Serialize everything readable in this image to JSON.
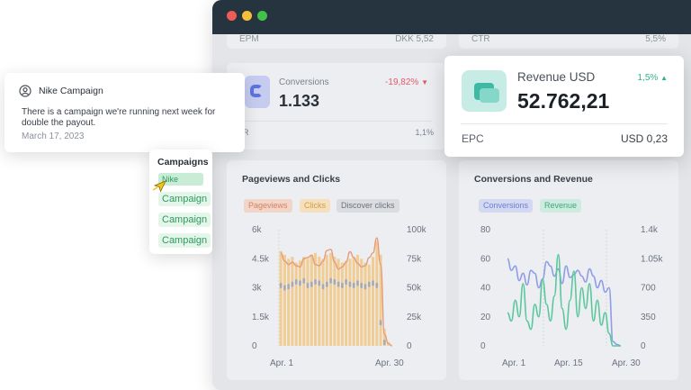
{
  "window": {},
  "top_row": {
    "epm_label": "EPM",
    "epm_value": "DKK 5,52",
    "ctr_label": "CTR",
    "ctr_value": "5,5%"
  },
  "conversions_card": {
    "title": "Conversions",
    "value": "1.133",
    "change": "-19,82%",
    "sub_label": "R",
    "sub_value": "1,1%"
  },
  "revenue_card": {
    "title": "Revenue USD",
    "change": "1,5%",
    "value": "52.762,21",
    "epc_label": "EPC",
    "epc_value": "USD 0,23"
  },
  "notification": {
    "title": "Nike Campaign",
    "body": "There is a campaign we're running next week for double the payout.",
    "date": "March 17, 2023"
  },
  "campaigns_popup": {
    "title": "Campaigns",
    "items": [
      "Nike",
      "Campaign",
      "Campaign",
      "Campaign"
    ]
  },
  "colors": {
    "pageviews": "#e59b7c",
    "clicks": "#f2c98a",
    "conversions": "#8f9de6",
    "revenue": "#5cc79c",
    "negative": "#e05a6a",
    "positive": "#2fb58f"
  },
  "chart_data": [
    {
      "type": "bar",
      "title": "Pageviews and Clicks",
      "legend": [
        "Pageviews",
        "Clicks",
        "Discover clicks"
      ],
      "x_tick_labels": [
        "Apr. 1",
        "Apr. 30"
      ],
      "y_left_ticks": [
        "6k",
        "4.5k",
        "3k",
        "1.5k",
        "0"
      ],
      "y_right_ticks": [
        "100k",
        "75k",
        "50k",
        "25k",
        "0"
      ],
      "ylim_left": [
        0,
        6000
      ],
      "ylim_right": [
        0,
        100000
      ],
      "series": [
        {
          "name": "Clicks",
          "values": [
            4900,
            4700,
            4500,
            4600,
            4300,
            4400,
            4600,
            4500,
            4700,
            4800,
            4600,
            4500,
            4700,
            4800,
            4600,
            4500,
            4300,
            4400,
            4500,
            4600,
            4700,
            4500,
            4300,
            4200,
            4600,
            5400,
            4700,
            900,
            200,
            0
          ]
        },
        {
          "name": "Pageviews",
          "values": [
            80000,
            73000,
            70000,
            72000,
            69000,
            68000,
            75000,
            76000,
            78000,
            70000,
            69000,
            73000,
            82000,
            83000,
            72000,
            66000,
            68000,
            72000,
            81000,
            76000,
            71000,
            68000,
            69000,
            76000,
            80000,
            93000,
            70000,
            10000,
            2000,
            0
          ]
        },
        {
          "name": "Discover clicks",
          "values": [
            52000,
            50000,
            51000,
            53000,
            55000,
            54000,
            56000,
            52000,
            53000,
            55000,
            54000,
            51000,
            53000,
            56000,
            55000,
            53000,
            52000,
            55000,
            53000,
            52000,
            54000,
            52000,
            51000,
            53000,
            54000,
            52000,
            20000,
            3000,
            0,
            0
          ]
        }
      ]
    },
    {
      "type": "line",
      "title": "Conversions and Revenue",
      "legend": [
        "Conversions",
        "Revenue"
      ],
      "x_tick_labels": [
        "Apr. 1",
        "Apr. 15",
        "Apr. 30"
      ],
      "y_left_ticks": [
        "80",
        "60",
        "40",
        "20",
        "0"
      ],
      "y_right_ticks": [
        "1.4k",
        "1.05k",
        "700",
        "350",
        "0"
      ],
      "ylim_left": [
        0,
        80
      ],
      "ylim_right": [
        0,
        1400
      ],
      "series": [
        {
          "name": "Conversions",
          "values": [
            60,
            52,
            55,
            45,
            50,
            42,
            52,
            50,
            40,
            46,
            58,
            55,
            48,
            53,
            43,
            55,
            47,
            49,
            52,
            48,
            44,
            53,
            48,
            40,
            45,
            37,
            40,
            3,
            1,
            0
          ]
        },
        {
          "name": "Revenue",
          "values": [
            400,
            300,
            550,
            350,
            750,
            300,
            200,
            500,
            350,
            800,
            500,
            300,
            600,
            1100,
            450,
            200,
            550,
            900,
            350,
            700,
            450,
            750,
            300,
            550,
            250,
            400,
            150,
            0,
            0,
            0
          ]
        }
      ]
    }
  ]
}
